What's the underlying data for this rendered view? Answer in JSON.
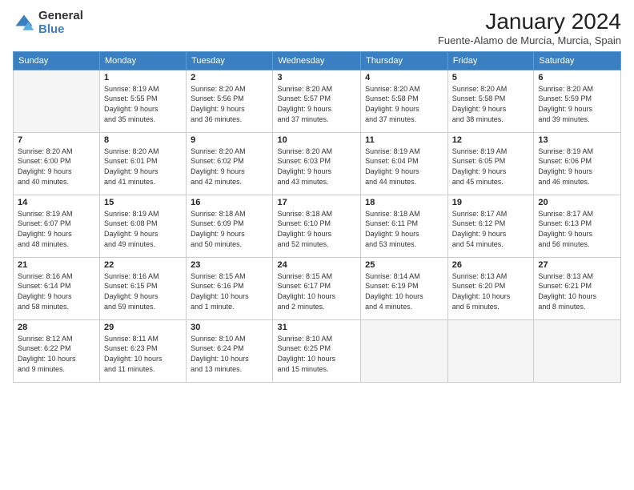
{
  "logo": {
    "general": "General",
    "blue": "Blue"
  },
  "title": "January 2024",
  "location": "Fuente-Alamo de Murcia, Murcia, Spain",
  "days_of_week": [
    "Sunday",
    "Monday",
    "Tuesday",
    "Wednesday",
    "Thursday",
    "Friday",
    "Saturday"
  ],
  "weeks": [
    [
      {
        "num": "",
        "info": ""
      },
      {
        "num": "1",
        "info": "Sunrise: 8:19 AM\nSunset: 5:55 PM\nDaylight: 9 hours\nand 35 minutes."
      },
      {
        "num": "2",
        "info": "Sunrise: 8:20 AM\nSunset: 5:56 PM\nDaylight: 9 hours\nand 36 minutes."
      },
      {
        "num": "3",
        "info": "Sunrise: 8:20 AM\nSunset: 5:57 PM\nDaylight: 9 hours\nand 37 minutes."
      },
      {
        "num": "4",
        "info": "Sunrise: 8:20 AM\nSunset: 5:58 PM\nDaylight: 9 hours\nand 37 minutes."
      },
      {
        "num": "5",
        "info": "Sunrise: 8:20 AM\nSunset: 5:58 PM\nDaylight: 9 hours\nand 38 minutes."
      },
      {
        "num": "6",
        "info": "Sunrise: 8:20 AM\nSunset: 5:59 PM\nDaylight: 9 hours\nand 39 minutes."
      }
    ],
    [
      {
        "num": "7",
        "info": "Sunrise: 8:20 AM\nSunset: 6:00 PM\nDaylight: 9 hours\nand 40 minutes."
      },
      {
        "num": "8",
        "info": "Sunrise: 8:20 AM\nSunset: 6:01 PM\nDaylight: 9 hours\nand 41 minutes."
      },
      {
        "num": "9",
        "info": "Sunrise: 8:20 AM\nSunset: 6:02 PM\nDaylight: 9 hours\nand 42 minutes."
      },
      {
        "num": "10",
        "info": "Sunrise: 8:20 AM\nSunset: 6:03 PM\nDaylight: 9 hours\nand 43 minutes."
      },
      {
        "num": "11",
        "info": "Sunrise: 8:19 AM\nSunset: 6:04 PM\nDaylight: 9 hours\nand 44 minutes."
      },
      {
        "num": "12",
        "info": "Sunrise: 8:19 AM\nSunset: 6:05 PM\nDaylight: 9 hours\nand 45 minutes."
      },
      {
        "num": "13",
        "info": "Sunrise: 8:19 AM\nSunset: 6:06 PM\nDaylight: 9 hours\nand 46 minutes."
      }
    ],
    [
      {
        "num": "14",
        "info": "Sunrise: 8:19 AM\nSunset: 6:07 PM\nDaylight: 9 hours\nand 48 minutes."
      },
      {
        "num": "15",
        "info": "Sunrise: 8:19 AM\nSunset: 6:08 PM\nDaylight: 9 hours\nand 49 minutes."
      },
      {
        "num": "16",
        "info": "Sunrise: 8:18 AM\nSunset: 6:09 PM\nDaylight: 9 hours\nand 50 minutes."
      },
      {
        "num": "17",
        "info": "Sunrise: 8:18 AM\nSunset: 6:10 PM\nDaylight: 9 hours\nand 52 minutes."
      },
      {
        "num": "18",
        "info": "Sunrise: 8:18 AM\nSunset: 6:11 PM\nDaylight: 9 hours\nand 53 minutes."
      },
      {
        "num": "19",
        "info": "Sunrise: 8:17 AM\nSunset: 6:12 PM\nDaylight: 9 hours\nand 54 minutes."
      },
      {
        "num": "20",
        "info": "Sunrise: 8:17 AM\nSunset: 6:13 PM\nDaylight: 9 hours\nand 56 minutes."
      }
    ],
    [
      {
        "num": "21",
        "info": "Sunrise: 8:16 AM\nSunset: 6:14 PM\nDaylight: 9 hours\nand 58 minutes."
      },
      {
        "num": "22",
        "info": "Sunrise: 8:16 AM\nSunset: 6:15 PM\nDaylight: 9 hours\nand 59 minutes."
      },
      {
        "num": "23",
        "info": "Sunrise: 8:15 AM\nSunset: 6:16 PM\nDaylight: 10 hours\nand 1 minute."
      },
      {
        "num": "24",
        "info": "Sunrise: 8:15 AM\nSunset: 6:17 PM\nDaylight: 10 hours\nand 2 minutes."
      },
      {
        "num": "25",
        "info": "Sunrise: 8:14 AM\nSunset: 6:19 PM\nDaylight: 10 hours\nand 4 minutes."
      },
      {
        "num": "26",
        "info": "Sunrise: 8:13 AM\nSunset: 6:20 PM\nDaylight: 10 hours\nand 6 minutes."
      },
      {
        "num": "27",
        "info": "Sunrise: 8:13 AM\nSunset: 6:21 PM\nDaylight: 10 hours\nand 8 minutes."
      }
    ],
    [
      {
        "num": "28",
        "info": "Sunrise: 8:12 AM\nSunset: 6:22 PM\nDaylight: 10 hours\nand 9 minutes."
      },
      {
        "num": "29",
        "info": "Sunrise: 8:11 AM\nSunset: 6:23 PM\nDaylight: 10 hours\nand 11 minutes."
      },
      {
        "num": "30",
        "info": "Sunrise: 8:10 AM\nSunset: 6:24 PM\nDaylight: 10 hours\nand 13 minutes."
      },
      {
        "num": "31",
        "info": "Sunrise: 8:10 AM\nSunset: 6:25 PM\nDaylight: 10 hours\nand 15 minutes."
      },
      {
        "num": "",
        "info": ""
      },
      {
        "num": "",
        "info": ""
      },
      {
        "num": "",
        "info": ""
      }
    ]
  ]
}
